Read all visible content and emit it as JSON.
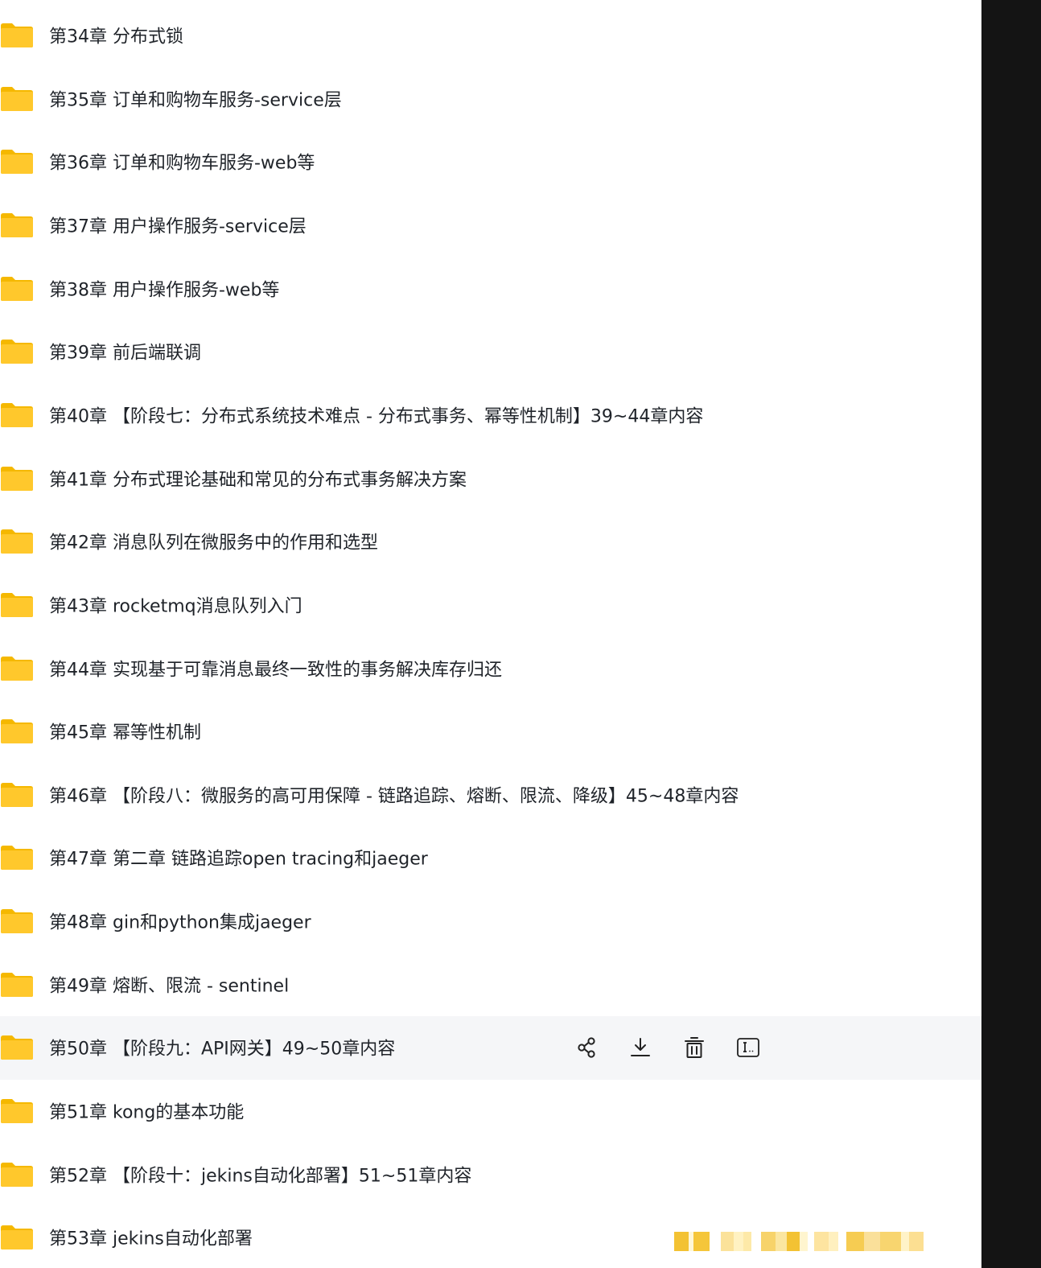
{
  "list": {
    "items": [
      {
        "label": "第34章 分布式锁"
      },
      {
        "label": "第35章 订单和购物车服务-service层"
      },
      {
        "label": "第36章 订单和购物车服务-web等"
      },
      {
        "label": "第37章 用户操作服务-service层"
      },
      {
        "label": "第38章 用户操作服务-web等"
      },
      {
        "label": "第39章 前后端联调"
      },
      {
        "label": "第40章 【阶段七：分布式系统技术难点 - 分布式事务、幂等性机制】39~44章内容"
      },
      {
        "label": "第41章 分布式理论基础和常见的分布式事务解决方案"
      },
      {
        "label": "第42章 消息队列在微服务中的作用和选型"
      },
      {
        "label": "第43章 rocketmq消息队列入门"
      },
      {
        "label": "第44章 实现基于可靠消息最终一致性的事务解决库存归还"
      },
      {
        "label": "第45章 幂等性机制"
      },
      {
        "label": "第46章 【阶段八：微服务的高可用保障 - 链路追踪、熔断、限流、降级】45~48章内容"
      },
      {
        "label": "第47章 第二章 链路追踪open tracing和jaeger"
      },
      {
        "label": "第48章 gin和python集成jaeger"
      },
      {
        "label": "第49章 熔断、限流 - sentinel"
      },
      {
        "label": "第50章 【阶段九：API网关】49~50章内容"
      },
      {
        "label": "第51章 kong的基本功能"
      },
      {
        "label": "第52章 【阶段十：jekins自动化部署】51~51章内容"
      },
      {
        "label": "第53章 jekins自动化部署"
      }
    ],
    "hovered_index": 16,
    "row_actions": [
      "share-icon",
      "download-icon",
      "delete-icon",
      "rename-icon"
    ]
  },
  "colors": {
    "folder": "#FFC82C",
    "folder_back": "#F5B800",
    "text": "#1f2329",
    "hover_bg": "#f5f6f8",
    "side_dark": "#141414"
  }
}
